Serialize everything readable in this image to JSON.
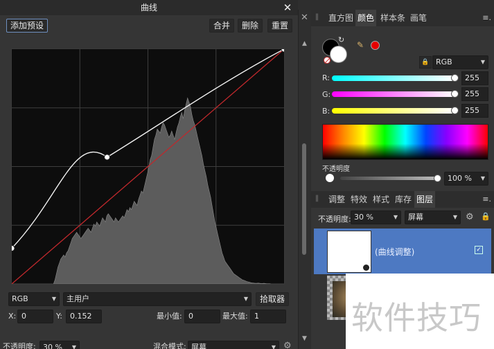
{
  "dialog": {
    "title": "曲线",
    "close_glyph": "✕",
    "add_preset_label": "添加预设",
    "merge_label": "合并",
    "delete_label": "删除",
    "reset_label": "重置",
    "channel": "RGB",
    "target": "主用户",
    "picker_label": "拾取器",
    "x_label": "X:",
    "x_value": "0",
    "y_label": "Y:",
    "y_value": "0.152",
    "min_label": "最小值:",
    "min_value": "0",
    "max_label": "最大值:",
    "max_value": "1",
    "opacity_label": "不透明度:",
    "opacity_value": "30 %",
    "blend_label": "混合模式:",
    "blend_value": "屏幕"
  },
  "curve": {
    "points": [
      [
        0,
        0.152
      ],
      [
        0.35,
        0.54
      ],
      [
        1,
        1
      ]
    ],
    "colors": {
      "curve": "#f0f0f0",
      "baseline": "#c0282c",
      "histogram": "#5c5c5c"
    }
  },
  "histogram": [
    0,
    0,
    0,
    0,
    0,
    0,
    0,
    0,
    0,
    0,
    0,
    0,
    0,
    0,
    0,
    0,
    0,
    0,
    0,
    0,
    0,
    0,
    0,
    0,
    0,
    0,
    0,
    0,
    0,
    0,
    0.02,
    0.05,
    0.08,
    0.1,
    0.12,
    0.13,
    0.14,
    0.13,
    0.15,
    0.16,
    0.18,
    0.2,
    0.22,
    0.23,
    0.24,
    0.25,
    0.24,
    0.23,
    0.22,
    0.23,
    0.24,
    0.25,
    0.26,
    0.27,
    0.26,
    0.25,
    0.27,
    0.29,
    0.28,
    0.3,
    0.29,
    0.28,
    0.3,
    0.32,
    0.31,
    0.3,
    0.33,
    0.34,
    0.33,
    0.32,
    0.31,
    0.3,
    0.32,
    0.31,
    0.3,
    0.31,
    0.32,
    0.33,
    0.32,
    0.34,
    0.36,
    0.35,
    0.37,
    0.36,
    0.38,
    0.4,
    0.39,
    0.38,
    0.41,
    0.43,
    0.45,
    0.44,
    0.47,
    0.5,
    0.53,
    0.56,
    0.6,
    0.62,
    0.66,
    0.7,
    0.72,
    0.75,
    0.74,
    0.73,
    0.76,
    0.78,
    0.77,
    0.75,
    0.73,
    0.71,
    0.72,
    0.74,
    0.72,
    0.7,
    0.73,
    0.76,
    0.78,
    0.81,
    0.83,
    0.8,
    0.84,
    0.87,
    0.9,
    0.88,
    0.86,
    0.82,
    0.79,
    0.77,
    0.74,
    0.71,
    0.68,
    0.65,
    0.62,
    0.58,
    0.55,
    0.52,
    0.48,
    0.45,
    0.42,
    0.38,
    0.34,
    0.3,
    0.27,
    0.24,
    0.21,
    0.18,
    0.15,
    0.13,
    0.11,
    0.1,
    0.09,
    0.08,
    0.07,
    0.06,
    0.05,
    0.045,
    0.04,
    0.035,
    0.03,
    0.025,
    0.02,
    0.018,
    0.015,
    0.012,
    0.01,
    0.008,
    0.006,
    0.005,
    0.004,
    0.003,
    0.003,
    0.004,
    0.003,
    0.002,
    0.002,
    0.003,
    0.002,
    0.001,
    0.001,
    0.001,
    0,
    0,
    0,
    0,
    0,
    0,
    0,
    0,
    0,
    0
  ],
  "right_panel": {
    "tabs_top": [
      "直方图",
      "颜色",
      "样本条",
      "画笔"
    ],
    "tabs_top_active": 1,
    "menu_glyph": "≡.",
    "color_model": "RGB",
    "channels": [
      {
        "label": "R:",
        "value": "255"
      },
      {
        "label": "G:",
        "value": "255"
      },
      {
        "label": "B:",
        "value": "255"
      }
    ],
    "swatch_colors": {
      "fill": "#000000",
      "stroke": "#ffffff",
      "accent": "#e60000"
    },
    "color_opacity_label": "不透明度",
    "color_opacity_value": "100 %",
    "tabs_bottom": [
      "调整",
      "特效",
      "样式",
      "库存",
      "图层"
    ],
    "tabs_bottom_active": 4,
    "layers_opacity_label": "不透明度:",
    "layers_opacity_value": "30 %",
    "layers_blend_value": "屏幕",
    "layers": [
      {
        "name": "(曲线调整)",
        "selected": true,
        "visible": true
      },
      {
        "name": "",
        "selected": false
      }
    ]
  },
  "icons": {
    "close": "✕",
    "scroll_up": "▲",
    "scroll_down": "▼",
    "gear": "⚙",
    "lock": "🔒",
    "dropper": "✎",
    "swap": "↻",
    "check": "✓",
    "dropdown": "▼"
  },
  "watermark_text": "软件技巧"
}
